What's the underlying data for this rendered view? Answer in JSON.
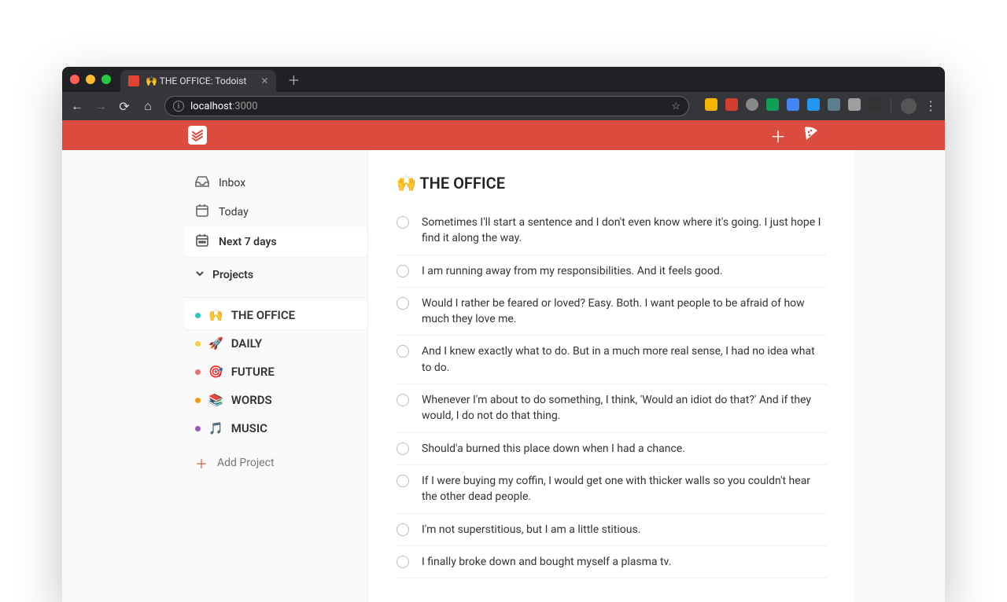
{
  "browser": {
    "tab_title": "🙌 THE OFFICE: Todoist",
    "url_host": "localhost",
    "url_port": ":3000"
  },
  "header": {
    "accent": "#db4c3f"
  },
  "sidebar": {
    "items": [
      {
        "label": "Inbox"
      },
      {
        "label": "Today"
      },
      {
        "label": "Next 7 days"
      }
    ],
    "projects_label": "Projects",
    "projects": [
      {
        "emoji": "🙌",
        "label": "THE OFFICE",
        "color": "#29c5c0"
      },
      {
        "emoji": "🚀",
        "label": "DAILY",
        "color": "#f4d03f"
      },
      {
        "emoji": "🎯",
        "label": "FUTURE",
        "color": "#e57373"
      },
      {
        "emoji": "📚",
        "label": "WORDS",
        "color": "#f39c12"
      },
      {
        "emoji": "🎵",
        "label": "MUSIC",
        "color": "#9b59b6"
      }
    ],
    "add_project_label": "Add Project"
  },
  "main": {
    "title": "🙌 THE OFFICE",
    "tasks": [
      "Sometimes I'll start a sentence and I don't even know where it's going. I just hope I find it along the way.",
      "I am running away from my responsibilities. And it feels good.",
      "Would I rather be feared or loved? Easy. Both. I want people to be afraid of how much they love me.",
      "And I knew exactly what to do. But in a much more real sense, I had no idea what to do.",
      "Whenever I'm about to do something, I think, 'Would an idiot do that?' And if they would, I do not do that thing.",
      "Should'a burned this place down when I had a chance.",
      "If I were buying my coffin, I would get one with thicker walls so you couldn't hear the other dead people.",
      "I'm not superstitious, but I am a little stitious.",
      "I finally broke down and bought myself a plasma tv."
    ]
  }
}
